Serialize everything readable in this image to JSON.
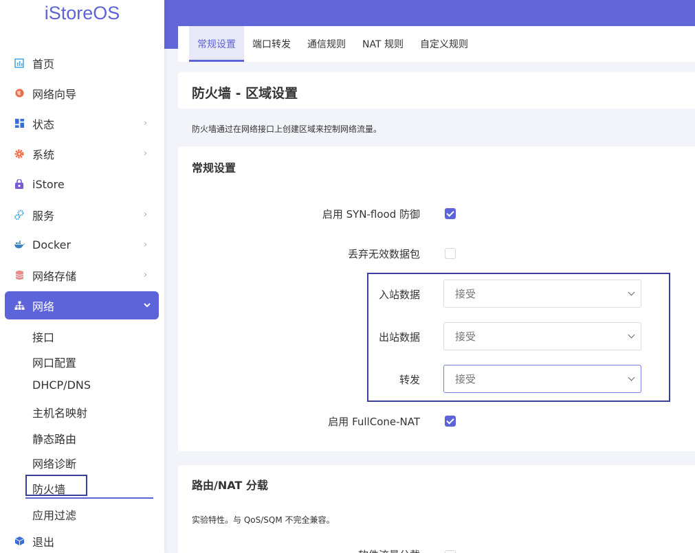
{
  "app": {
    "logo": "iStoreOS"
  },
  "sidebar": {
    "items": [
      {
        "label": "首页",
        "icon": "dashboard-icon",
        "icon_color": "#4aa3df",
        "has_arrow": false
      },
      {
        "label": "网络向导",
        "icon": "globe-icon",
        "icon_color": "#e96b4c",
        "has_arrow": false
      },
      {
        "label": "状态",
        "icon": "grid-icon",
        "icon_color": "#3b6fd4",
        "has_arrow": true
      },
      {
        "label": "系统",
        "icon": "gear-icon",
        "icon_color": "#f06a3c",
        "has_arrow": true
      },
      {
        "label": "iStore",
        "icon": "store-icon",
        "icon_color": "#7a5ad8",
        "has_arrow": false
      },
      {
        "label": "服务",
        "icon": "services-icon",
        "icon_color": "#3aa7d8",
        "has_arrow": true
      },
      {
        "label": "Docker",
        "icon": "docker-icon",
        "icon_color": "#3b82c4",
        "has_arrow": true
      },
      {
        "label": "网络存储",
        "icon": "database-icon",
        "icon_color": "#e88a8a",
        "has_arrow": true
      },
      {
        "label": "网络",
        "icon": "network-icon",
        "icon_color": "#ffffff",
        "has_arrow": true,
        "active": true
      }
    ],
    "sub_items": [
      "接口",
      "网口配置",
      "DHCP/DNS",
      "主机名映射",
      "静态路由",
      "网络诊断",
      "防火墙",
      "应用过滤"
    ],
    "active_sub": "防火墙",
    "logout": {
      "label": "退出",
      "icon": "cube-icon",
      "icon_color": "#3b6fd4"
    }
  },
  "tabs": [
    "常规设置",
    "端口转发",
    "通信规则",
    "NAT 规则",
    "自定义规则"
  ],
  "active_tab": "常规设置",
  "page": {
    "title": "防火墙 - 区域设置",
    "description": "防火墙通过在网络接口上创建区域来控制网络流量。"
  },
  "general": {
    "title": "常规设置",
    "syn_flood": {
      "label": "启用 SYN-flood 防御",
      "checked": true
    },
    "drop_invalid": {
      "label": "丢弃无效数据包",
      "checked": false
    },
    "input": {
      "label": "入站数据",
      "value": "接受"
    },
    "output": {
      "label": "出站数据",
      "value": "接受"
    },
    "forward": {
      "label": "转发",
      "value": "接受"
    },
    "fullcone": {
      "label": "启用 FullCone-NAT",
      "checked": true
    }
  },
  "offload": {
    "title": "路由/NAT 分载",
    "description": "实验特性。与 QoS/SQM 不完全兼容。",
    "partial_label": "软件流量分载"
  },
  "colors": {
    "accent": "#5d63d8",
    "header": "#6167d9"
  }
}
